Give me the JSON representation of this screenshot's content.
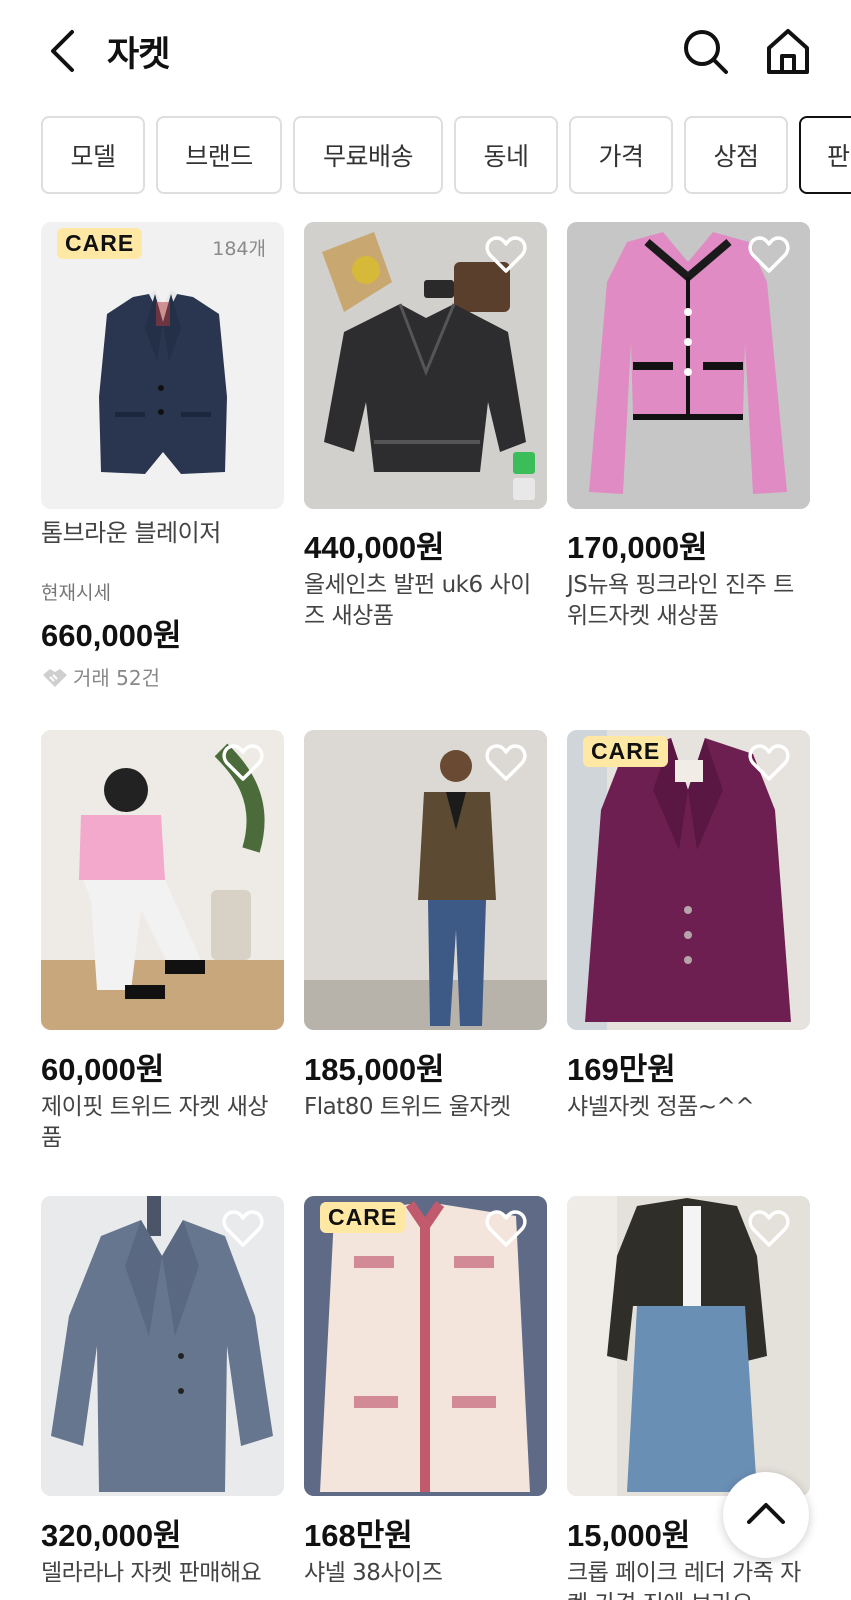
{
  "header": {
    "title": "자켓"
  },
  "filters": [
    "모델",
    "브랜드",
    "무료배송",
    "동네",
    "가격",
    "상점",
    "판"
  ],
  "featured": {
    "badge": "CARE",
    "count": "184개",
    "name": "톰브라운 블레이저",
    "market_label": "현재시세",
    "price": "660,000원",
    "trades": "거래 52건"
  },
  "products": [
    {
      "price": "440,000원",
      "name": "올세인츠 발펀 uk6 사이즈 새상품"
    },
    {
      "price": "170,000원",
      "name": "JS뉴욕 핑크라인 진주 트위드자켓 새상품"
    },
    {
      "price": "60,000원",
      "name": "제이핏 트위드 자켓 새상품"
    },
    {
      "price": "185,000원",
      "name": "Flat80 트위드 울자켓"
    },
    {
      "price": "169만원",
      "name": "샤넬자켓 정품~^^",
      "badge": "CARE"
    },
    {
      "price": "320,000원",
      "name": "델라라나 자켓 판매해요"
    },
    {
      "price": "168만원",
      "name": "샤넬  38사이즈",
      "badge": "CARE"
    },
    {
      "price": "15,000원",
      "name": "크롭 페이크 레더 가죽 자켓 가격 진에 보라요"
    }
  ],
  "colors": {
    "care_badge": "#ffe7a4",
    "chip_border": "#dedede"
  }
}
